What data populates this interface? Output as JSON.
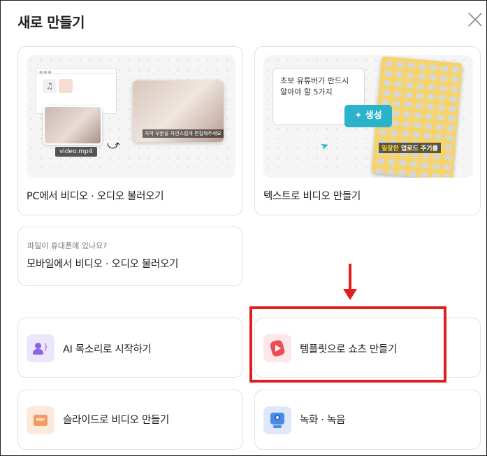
{
  "dialog": {
    "title": "새로 만들기"
  },
  "cards": {
    "pc": {
      "label": "PC에서 비디오 · 오디오 불러오기",
      "badge": "video.mp4",
      "subtitle": "자막 부분을 자연스럽게 편집해주세요"
    },
    "text": {
      "label": "텍스트로 비디오 만들기",
      "prompt": "초보 유튜버가 반드시 알아야 할 5가지",
      "generate_button": "생성",
      "caption_highlight": "일잘한",
      "caption_rest": " 업로드 주기를"
    },
    "mobile": {
      "note": "파일이 휴대폰에 있나요?",
      "label": "모바일에서 비디오 · 오디오 불러오기"
    },
    "ai_voice": {
      "label": "AI 목소리로 시작하기",
      "icon": "voice-avatar-icon"
    },
    "shorts": {
      "label": "템플릿으로 쇼츠 만들기",
      "icon": "shorts-icon"
    },
    "slides": {
      "label": "슬라이드로 비디오 만들기",
      "icon": "pdf-icon",
      "icon_text": "PDF"
    },
    "record": {
      "label": "녹화 · 녹음",
      "icon": "webcam-icon"
    }
  },
  "annotation": {
    "color": "#e01e1e"
  }
}
